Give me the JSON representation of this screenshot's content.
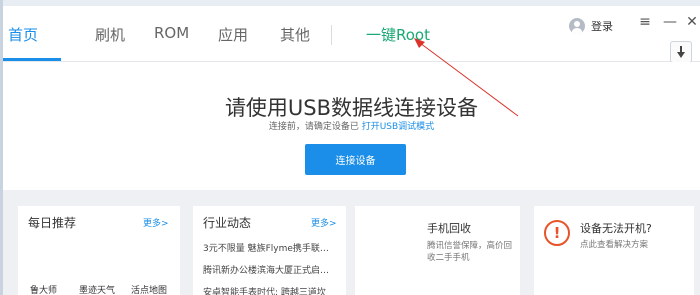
{
  "nav": {
    "tabs": [
      {
        "label": "首页",
        "active": true
      },
      {
        "label": "刷机",
        "active": false
      },
      {
        "label": "ROM",
        "active": false
      },
      {
        "label": "应用",
        "active": false
      },
      {
        "label": "其他",
        "active": false
      }
    ],
    "root_tab": "一键Root"
  },
  "header": {
    "login_label": "登录",
    "window_controls": {
      "menu": "≡",
      "minimize": "—",
      "close": "✕"
    }
  },
  "main": {
    "title": "请使用USB数据线连接设备",
    "subtitle_prefix": "连接前，请确定设备已",
    "subtitle_link": "打开USB调试模式",
    "connect_button": "连接设备"
  },
  "cards": {
    "recommend": {
      "title": "每日推荐",
      "more": "更多>",
      "items": [
        "鲁大师",
        "墨迹天气",
        "活点地图"
      ]
    },
    "news": {
      "title": "行业动态",
      "more": "更多>",
      "items": [
        "3元不限量 魅族Flyme携手联…",
        "腾讯新办公楼滨海大厦正式启…",
        "安卓智能手表时代: 跨越三道坎"
      ]
    },
    "recycle": {
      "title": "手机回收",
      "desc": "腾讯信誉保障，高价回收二手手机"
    },
    "help": {
      "title": "设备无法开机?",
      "desc": "点此查看解决方案"
    }
  },
  "colors": {
    "accent": "#1a8ee8",
    "root_green": "#19a974",
    "annotation_red": "#d9332a",
    "warning_orange": "#e8542a"
  }
}
